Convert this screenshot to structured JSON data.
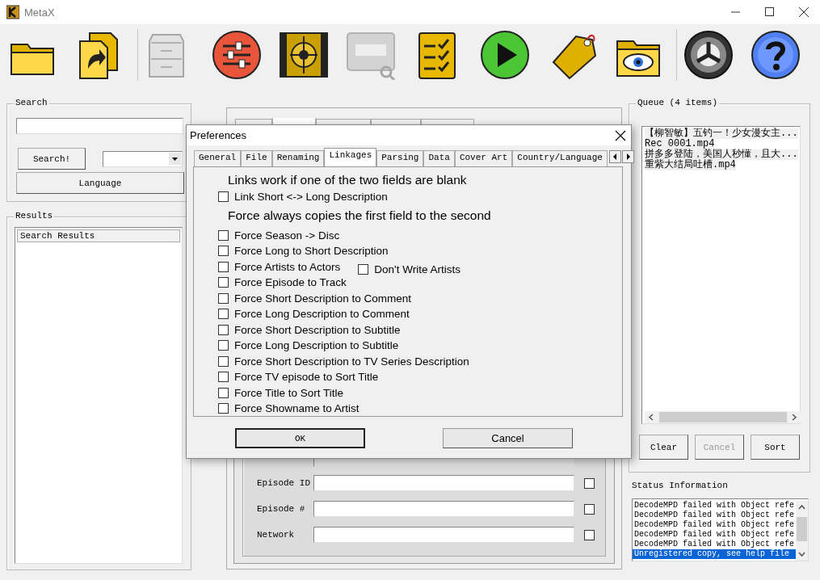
{
  "window": {
    "title": "MetaX"
  },
  "toolbar": [
    {
      "kind": "folder",
      "disabled": false
    },
    {
      "kind": "copy",
      "disabled": false
    },
    {
      "kind": "separator"
    },
    {
      "kind": "cabinet",
      "disabled": true
    },
    {
      "kind": "sliders",
      "disabled": false
    },
    {
      "kind": "film",
      "disabled": false
    },
    {
      "kind": "lookup",
      "disabled": true
    },
    {
      "kind": "checklist",
      "disabled": false
    },
    {
      "kind": "play",
      "disabled": false
    },
    {
      "kind": "tag",
      "disabled": false
    },
    {
      "kind": "eyefolder",
      "disabled": false
    },
    {
      "kind": "separator"
    },
    {
      "kind": "wheel",
      "disabled": false
    },
    {
      "kind": "help",
      "disabled": false
    }
  ],
  "search": {
    "title": "Search",
    "search_button": "Search!",
    "language_button": "Language"
  },
  "results": {
    "title": "Results",
    "column": "Search Results"
  },
  "editor": {
    "tabs": [
      {
        "selected": false
      },
      {
        "selected": true
      },
      {
        "selected": false
      },
      {
        "selected": false
      },
      {
        "selected": false
      }
    ],
    "fields": [
      {
        "label": "Episode ID",
        "checked": false
      },
      {
        "label": "Episode #",
        "checked": false
      },
      {
        "label": "Network",
        "checked": false
      }
    ]
  },
  "queue": {
    "title": "Queue (4 items)",
    "items": [
      "【柳智敏】五钓一！少女漫女主...",
      "Rec 0001.mp4",
      "拼多多登陆，美国人秒懂，且大...",
      "重紫大结局吐槽.mp4"
    ],
    "buttons": [
      {
        "label": "Clear",
        "disabled": false
      },
      {
        "label": "Cancel",
        "disabled": true
      },
      {
        "label": "Sort",
        "disabled": false
      }
    ]
  },
  "status": {
    "title": "Status Information",
    "lines": [
      {
        "text": "DecodeMPD failed with Object refe",
        "selected": false
      },
      {
        "text": "DecodeMPD failed with Object refe",
        "selected": false
      },
      {
        "text": "DecodeMPD failed with Object refe",
        "selected": false
      },
      {
        "text": "DecodeMPD failed with Object refe",
        "selected": false
      },
      {
        "text": "DecodeMPD failed with Object refe",
        "selected": false
      },
      {
        "text": "Unregistered copy, see help file",
        "selected": true
      }
    ]
  },
  "dialog": {
    "title": "Preferences",
    "tabs": [
      {
        "label": "General",
        "selected": false
      },
      {
        "label": "File",
        "selected": false
      },
      {
        "label": "Renaming",
        "selected": false
      },
      {
        "label": "Linkages",
        "selected": true
      },
      {
        "label": "Parsing",
        "selected": false
      },
      {
        "label": "Data",
        "selected": false
      },
      {
        "label": "Cover Art",
        "selected": false
      },
      {
        "label": "Country/Language",
        "selected": false
      }
    ],
    "sections": [
      {
        "heading": "Links work if one of the two fields are blank",
        "options": [
          {
            "label": "Link Short <-> Long Description",
            "checked": false
          }
        ]
      },
      {
        "heading": "Force always copies the first field to the second",
        "options": [
          {
            "label": "Force Season -> Disc",
            "checked": false
          },
          {
            "label": "Force Long to Short Description",
            "checked": false
          },
          {
            "label": "Force Artists to Actors",
            "checked": false,
            "side": {
              "label": "Don't Write Artists",
              "checked": false
            }
          },
          {
            "label": "Force Episode to Track",
            "checked": false
          },
          {
            "label": "Force Short Description to Comment",
            "checked": false
          },
          {
            "label": "Force Long Description to Comment",
            "checked": false
          },
          {
            "label": "Force Short Description to Subtitle",
            "checked": false
          },
          {
            "label": "Force Long Description to Subtitle",
            "checked": false
          },
          {
            "label": "Force Short Description to TV Series Description",
            "checked": false
          },
          {
            "label": "Force TV episode to Sort Title",
            "checked": false
          },
          {
            "label": "Force Title to Sort Title",
            "checked": false
          },
          {
            "label": "Force Showname to Artist",
            "checked": false
          }
        ]
      }
    ],
    "ok": "OK",
    "cancel": "Cancel"
  }
}
